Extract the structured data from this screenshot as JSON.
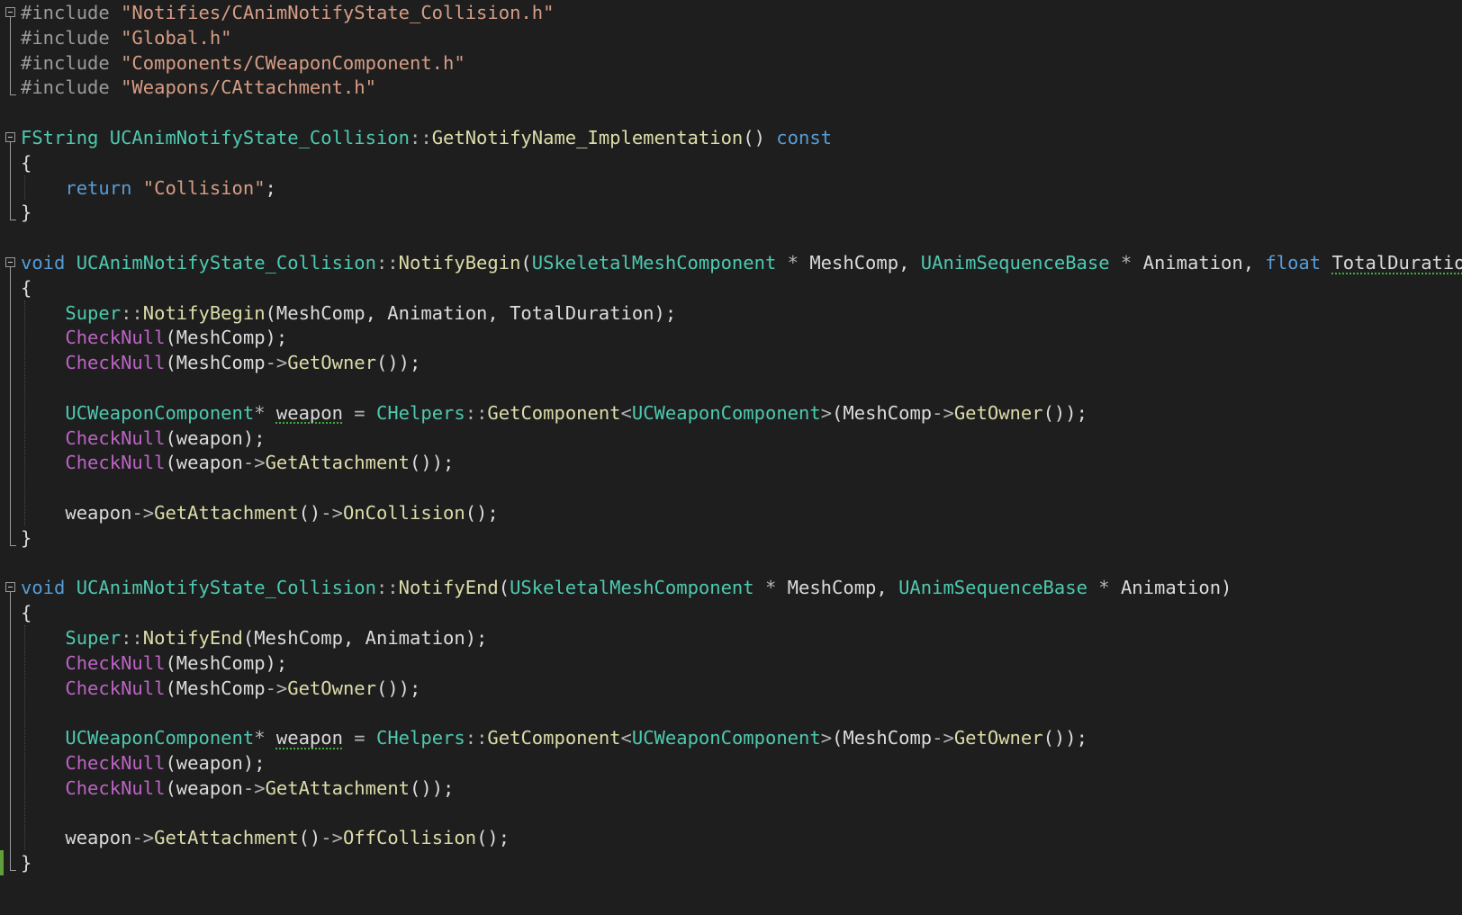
{
  "editor": {
    "lines": [
      [
        {
          "t": "#include ",
          "c": "inc"
        },
        {
          "t": "\"Notifies/CAnimNotifyState_Collision.h\"",
          "c": "str"
        }
      ],
      [
        {
          "t": "#include ",
          "c": "inc"
        },
        {
          "t": "\"Global.h\"",
          "c": "str"
        }
      ],
      [
        {
          "t": "#include ",
          "c": "inc"
        },
        {
          "t": "\"Components/CWeaponComponent.h\"",
          "c": "str"
        }
      ],
      [
        {
          "t": "#include ",
          "c": "inc"
        },
        {
          "t": "\"Weapons/CAttachment.h\"",
          "c": "str"
        }
      ],
      [],
      [
        {
          "t": "FString",
          "c": "type"
        },
        {
          "t": " ",
          "c": "plain"
        },
        {
          "t": "UCAnimNotifyState_Collision",
          "c": "type"
        },
        {
          "t": "::",
          "c": "op"
        },
        {
          "t": "GetNotifyName_Implementation",
          "c": "fn"
        },
        {
          "t": "() ",
          "c": "plain"
        },
        {
          "t": "const",
          "c": "kw"
        }
      ],
      [
        {
          "t": "{",
          "c": "plain"
        }
      ],
      [
        {
          "t": "    ",
          "c": "plain"
        },
        {
          "t": "return",
          "c": "kw"
        },
        {
          "t": " ",
          "c": "plain"
        },
        {
          "t": "\"Collision\"",
          "c": "str"
        },
        {
          "t": ";",
          "c": "plain"
        }
      ],
      [
        {
          "t": "}",
          "c": "plain"
        }
      ],
      [],
      [
        {
          "t": "void",
          "c": "kw"
        },
        {
          "t": " ",
          "c": "plain"
        },
        {
          "t": "UCAnimNotifyState_Collision",
          "c": "type"
        },
        {
          "t": "::",
          "c": "op"
        },
        {
          "t": "NotifyBegin",
          "c": "fn"
        },
        {
          "t": "(",
          "c": "plain"
        },
        {
          "t": "USkeletalMeshComponent",
          "c": "type"
        },
        {
          "t": " * ",
          "c": "op"
        },
        {
          "t": "MeshComp",
          "c": "param"
        },
        {
          "t": ", ",
          "c": "plain"
        },
        {
          "t": "UAnimSequenceBase",
          "c": "type"
        },
        {
          "t": " * ",
          "c": "op"
        },
        {
          "t": "Animation",
          "c": "param"
        },
        {
          "t": ", ",
          "c": "plain"
        },
        {
          "t": "float",
          "c": "kw"
        },
        {
          "t": " ",
          "c": "plain"
        },
        {
          "t": "TotalDuration",
          "c": "param",
          "sq": true
        },
        {
          "t": ")",
          "c": "plain"
        }
      ],
      [
        {
          "t": "{",
          "c": "plain"
        }
      ],
      [
        {
          "t": "    ",
          "c": "plain"
        },
        {
          "t": "Super",
          "c": "type"
        },
        {
          "t": "::",
          "c": "op"
        },
        {
          "t": "NotifyBegin",
          "c": "fn"
        },
        {
          "t": "(MeshComp, Animation, TotalDuration);",
          "c": "plain"
        }
      ],
      [
        {
          "t": "    ",
          "c": "plain"
        },
        {
          "t": "CheckNull",
          "c": "macro"
        },
        {
          "t": "(MeshComp);",
          "c": "plain"
        }
      ],
      [
        {
          "t": "    ",
          "c": "plain"
        },
        {
          "t": "CheckNull",
          "c": "macro"
        },
        {
          "t": "(MeshComp",
          "c": "plain"
        },
        {
          "t": "->",
          "c": "op"
        },
        {
          "t": "GetOwner",
          "c": "fn"
        },
        {
          "t": "());",
          "c": "plain"
        }
      ],
      [],
      [
        {
          "t": "    ",
          "c": "plain"
        },
        {
          "t": "UCWeaponComponent",
          "c": "type"
        },
        {
          "t": "* ",
          "c": "op"
        },
        {
          "t": "weapon",
          "c": "var",
          "sq": true
        },
        {
          "t": " = ",
          "c": "op"
        },
        {
          "t": "CHelpers",
          "c": "type"
        },
        {
          "t": "::",
          "c": "op"
        },
        {
          "t": "GetComponent",
          "c": "fn"
        },
        {
          "t": "<",
          "c": "op"
        },
        {
          "t": "UCWeaponComponent",
          "c": "type"
        },
        {
          "t": ">",
          "c": "op"
        },
        {
          "t": "(MeshComp",
          "c": "plain"
        },
        {
          "t": "->",
          "c": "op"
        },
        {
          "t": "GetOwner",
          "c": "fn"
        },
        {
          "t": "());",
          "c": "plain"
        }
      ],
      [
        {
          "t": "    ",
          "c": "plain"
        },
        {
          "t": "CheckNull",
          "c": "macro"
        },
        {
          "t": "(weapon);",
          "c": "plain"
        }
      ],
      [
        {
          "t": "    ",
          "c": "plain"
        },
        {
          "t": "CheckNull",
          "c": "macro"
        },
        {
          "t": "(weapon",
          "c": "plain"
        },
        {
          "t": "->",
          "c": "op"
        },
        {
          "t": "GetAttachment",
          "c": "fn"
        },
        {
          "t": "());",
          "c": "plain"
        }
      ],
      [],
      [
        {
          "t": "    ",
          "c": "plain"
        },
        {
          "t": "weapon",
          "c": "var"
        },
        {
          "t": "->",
          "c": "op"
        },
        {
          "t": "GetAttachment",
          "c": "fn"
        },
        {
          "t": "()",
          "c": "plain"
        },
        {
          "t": "->",
          "c": "op"
        },
        {
          "t": "OnCollision",
          "c": "fn"
        },
        {
          "t": "();",
          "c": "plain"
        }
      ],
      [
        {
          "t": "}",
          "c": "plain"
        }
      ],
      [],
      [
        {
          "t": "void",
          "c": "kw"
        },
        {
          "t": " ",
          "c": "plain"
        },
        {
          "t": "UCAnimNotifyState_Collision",
          "c": "type"
        },
        {
          "t": "::",
          "c": "op"
        },
        {
          "t": "NotifyEnd",
          "c": "fn"
        },
        {
          "t": "(",
          "c": "plain"
        },
        {
          "t": "USkeletalMeshComponent",
          "c": "type"
        },
        {
          "t": " * ",
          "c": "op"
        },
        {
          "t": "MeshComp",
          "c": "param"
        },
        {
          "t": ", ",
          "c": "plain"
        },
        {
          "t": "UAnimSequenceBase",
          "c": "type"
        },
        {
          "t": " * ",
          "c": "op"
        },
        {
          "t": "Animation",
          "c": "param"
        },
        {
          "t": ")",
          "c": "plain"
        }
      ],
      [
        {
          "t": "{",
          "c": "plain"
        }
      ],
      [
        {
          "t": "    ",
          "c": "plain"
        },
        {
          "t": "Super",
          "c": "type"
        },
        {
          "t": "::",
          "c": "op"
        },
        {
          "t": "NotifyEnd",
          "c": "fn"
        },
        {
          "t": "(MeshComp, Animation);",
          "c": "plain"
        }
      ],
      [
        {
          "t": "    ",
          "c": "plain"
        },
        {
          "t": "CheckNull",
          "c": "macro"
        },
        {
          "t": "(MeshComp);",
          "c": "plain"
        }
      ],
      [
        {
          "t": "    ",
          "c": "plain"
        },
        {
          "t": "CheckNull",
          "c": "macro"
        },
        {
          "t": "(MeshComp",
          "c": "plain"
        },
        {
          "t": "->",
          "c": "op"
        },
        {
          "t": "GetOwner",
          "c": "fn"
        },
        {
          "t": "());",
          "c": "plain"
        }
      ],
      [],
      [
        {
          "t": "    ",
          "c": "plain"
        },
        {
          "t": "UCWeaponComponent",
          "c": "type"
        },
        {
          "t": "* ",
          "c": "op"
        },
        {
          "t": "weapon",
          "c": "var",
          "sq": true
        },
        {
          "t": " = ",
          "c": "op"
        },
        {
          "t": "CHelpers",
          "c": "type"
        },
        {
          "t": "::",
          "c": "op"
        },
        {
          "t": "GetComponent",
          "c": "fn"
        },
        {
          "t": "<",
          "c": "op"
        },
        {
          "t": "UCWeaponComponent",
          "c": "type"
        },
        {
          "t": ">",
          "c": "op"
        },
        {
          "t": "(MeshComp",
          "c": "plain"
        },
        {
          "t": "->",
          "c": "op"
        },
        {
          "t": "GetOwner",
          "c": "fn"
        },
        {
          "t": "());",
          "c": "plain"
        }
      ],
      [
        {
          "t": "    ",
          "c": "plain"
        },
        {
          "t": "CheckNull",
          "c": "macro"
        },
        {
          "t": "(weapon);",
          "c": "plain"
        }
      ],
      [
        {
          "t": "    ",
          "c": "plain"
        },
        {
          "t": "CheckNull",
          "c": "macro"
        },
        {
          "t": "(weapon",
          "c": "plain"
        },
        {
          "t": "->",
          "c": "op"
        },
        {
          "t": "GetAttachment",
          "c": "fn"
        },
        {
          "t": "());",
          "c": "plain"
        }
      ],
      [],
      [
        {
          "t": "    ",
          "c": "plain"
        },
        {
          "t": "weapon",
          "c": "var"
        },
        {
          "t": "->",
          "c": "op"
        },
        {
          "t": "GetAttachment",
          "c": "fn"
        },
        {
          "t": "()",
          "c": "plain"
        },
        {
          "t": "->",
          "c": "op"
        },
        {
          "t": "OffCollision",
          "c": "fn"
        },
        {
          "t": "();",
          "c": "plain"
        }
      ],
      [
        {
          "t": "}",
          "c": "plain"
        }
      ]
    ]
  }
}
